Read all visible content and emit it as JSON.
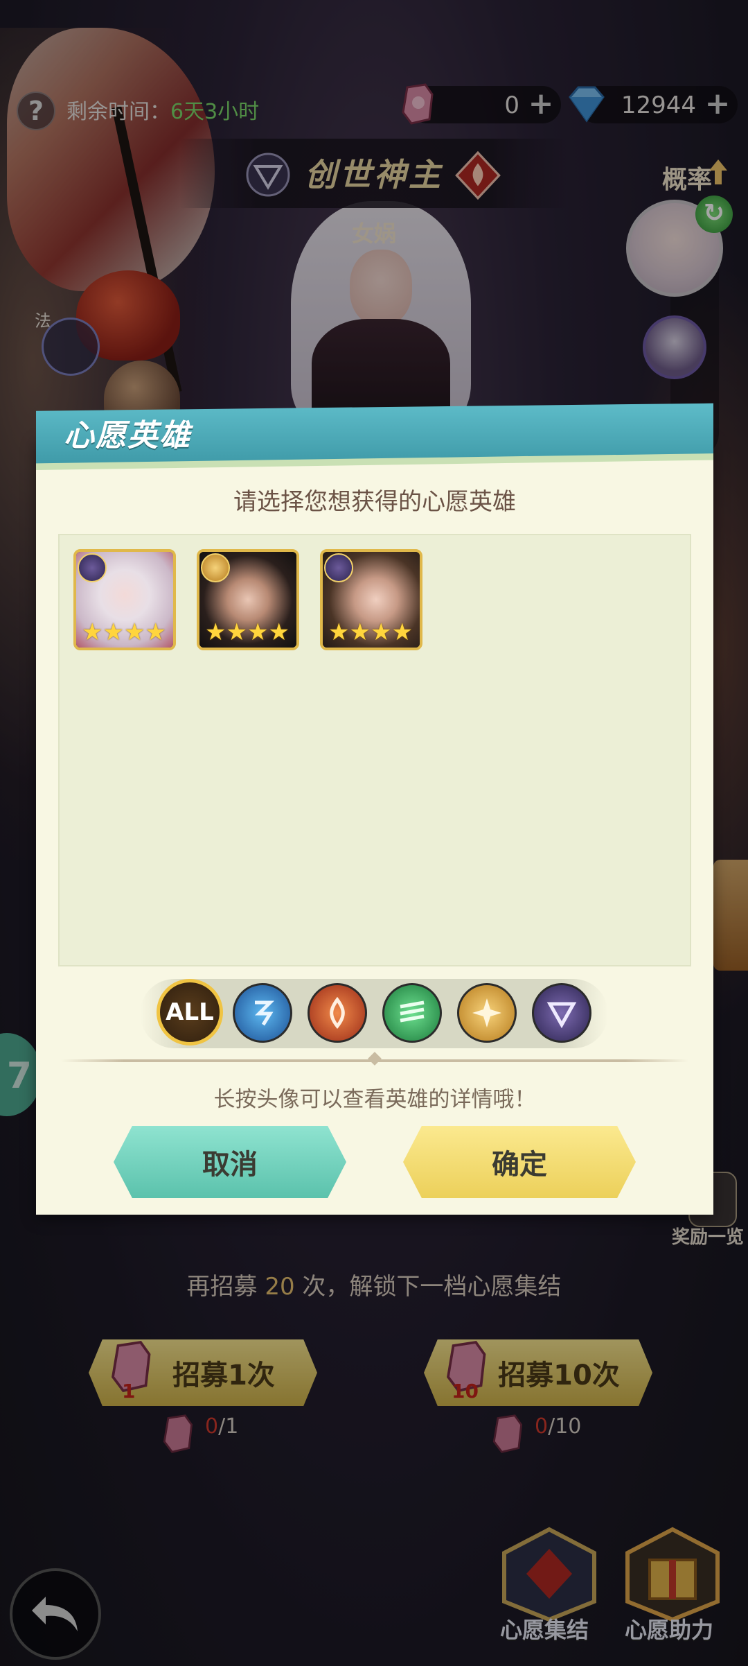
{
  "status_bar": {
    "remaining_label": "剩余时间：",
    "remaining_value": "6天3小时"
  },
  "resources": {
    "ticket": {
      "value": "0",
      "icon": "recruit-ticket-icon"
    },
    "diamond": {
      "value": "12944",
      "icon": "diamond-icon"
    },
    "plus_symbol": "+"
  },
  "banner": {
    "title": "创世神主",
    "hero_name": "女娲",
    "rate_label": "概率"
  },
  "side": {
    "left_tag": "法"
  },
  "dialog": {
    "title": "心愿英雄",
    "subtitle": "请选择您想获得的心愿英雄",
    "heroes": [
      {
        "faction": "void-faction-icon",
        "stars": "★★★★",
        "frame_color": "#e0b84a"
      },
      {
        "faction": "light-faction-icon",
        "stars": "★★★★",
        "frame_color": "#e0b84a"
      },
      {
        "faction": "void-faction-icon",
        "stars": "★★★★",
        "frame_color": "#e0b84a"
      }
    ],
    "filters": {
      "all_label": "ALL",
      "items": [
        "water-faction-icon",
        "fire-faction-icon",
        "wind-faction-icon",
        "light-faction-icon",
        "void-faction-icon"
      ]
    },
    "hint": "长按头像可以查看英雄的详情哦！",
    "cancel_label": "取消",
    "confirm_label": "确定"
  },
  "bottom": {
    "unlock_prefix": "再招募 ",
    "unlock_count": "20",
    "unlock_suffix": " 次，解锁下一档心愿集结",
    "recruit_1_label": "招募1次",
    "recruit_1_ticket_count": "1",
    "recruit_10_label": "招募10次",
    "recruit_10_ticket_count": "10",
    "cost_1_have": "0",
    "cost_1_need": "/1",
    "cost_10_have": "0",
    "cost_10_need": "/10",
    "reward_label": "奖励一览",
    "side_number": "7",
    "wish_gather_label": "心愿集结",
    "wish_help_label": "心愿助力"
  },
  "colors": {
    "accent_teal": "#4fb0be",
    "accent_gold": "#ecd05a",
    "paper": "#f8f7e3",
    "remaining_green": "#7cd96a",
    "cost_red": "#d13a2d"
  }
}
